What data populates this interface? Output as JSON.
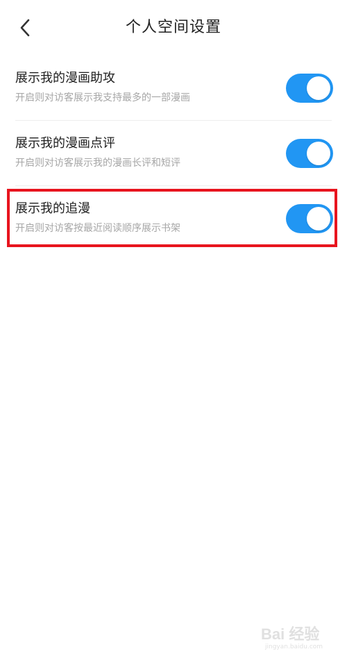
{
  "header": {
    "title": "个人空间设置",
    "back_icon": "chevron-left-icon"
  },
  "settings": [
    {
      "title": "展示我的漫画助攻",
      "description": "开启则对访客展示我支持最多的一部漫画",
      "enabled": true
    },
    {
      "title": "展示我的漫画点评",
      "description": "开启则对访客展示我的漫画长评和短评",
      "enabled": true
    },
    {
      "title": "展示我的追漫",
      "description": "开启则对访客按最近阅读顺序展示书架",
      "enabled": true
    }
  ],
  "colors": {
    "toggle_on": "#2196f3",
    "highlight": "#e8141e"
  },
  "watermark": {
    "text": "Bai 经验",
    "sub": "jingyan.baidu.com"
  }
}
